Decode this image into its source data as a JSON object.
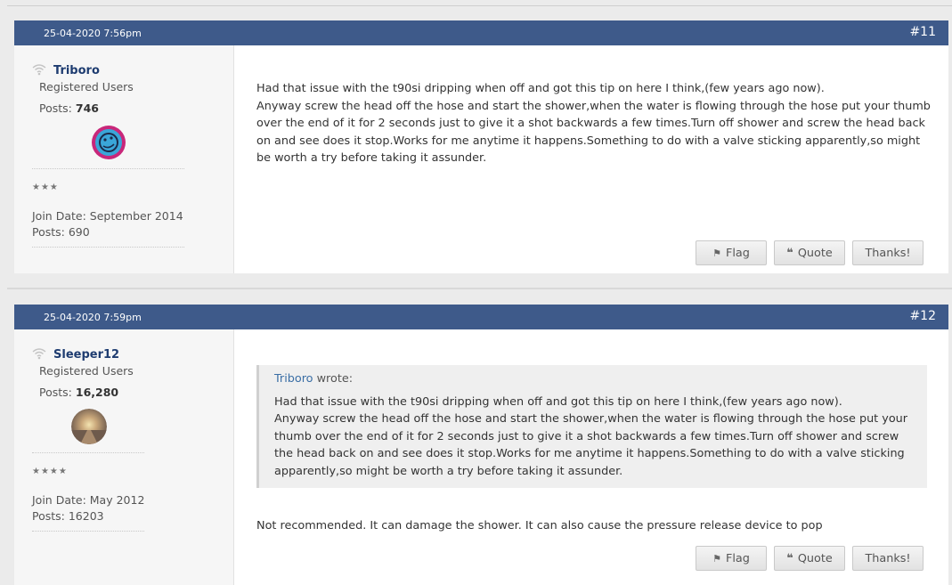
{
  "posts": [
    {
      "date": "25-04-2020 7:56pm",
      "number": "#11",
      "user": {
        "name": "Triboro",
        "title": "Registered Users",
        "posts_label": "Posts:",
        "posts_value": "746",
        "stars": "★★★",
        "join_date": "Join Date: September 2014",
        "posts_line": "Posts: 690"
      },
      "content": [
        "Had that issue with the t90si dripping when off and got this tip on here I think,(few years ago now).",
        "Anyway screw the head off the hose and start the shower,when the water is flowing through the hose put your thumb over the end of it for 2 seconds just to give it a shot backwards a few times.Turn off shower and screw the head back on and see does it stop.Works for me anytime it happens.Something to do with a valve sticking apparently,so might be worth a try before taking it assunder."
      ],
      "buttons": {
        "flag": "Flag",
        "quote": "Quote",
        "thanks": "Thanks!"
      }
    },
    {
      "date": "25-04-2020 7:59pm",
      "number": "#12",
      "user": {
        "name": "Sleeper12",
        "title": "Registered Users",
        "posts_label": "Posts:",
        "posts_value": "16,280",
        "stars": "★★★★",
        "join_date": "Join Date: May 2012",
        "posts_line": "Posts: 16203"
      },
      "quote": {
        "author": "Triboro",
        "wrote": "wrote:",
        "lines": [
          "Had that issue with the t90si dripping when off and got this tip on here I think,(few years ago now).",
          "Anyway screw the head off the hose and start the shower,when the water is flowing through the hose put your thumb over the end of it for 2 seconds just to give it a shot backwards a few times.Turn off shower and screw the head back on and see does it stop.Works for me anytime it happens.Something to do with a valve sticking apparently,so might be worth a try before taking it assunder."
        ]
      },
      "content": "Not recommended. It can damage the shower. It can also cause the pressure release device to pop",
      "buttons": {
        "flag": "Flag",
        "quote": "Quote",
        "thanks": "Thanks!"
      }
    }
  ],
  "colors": {
    "header": "#3e5a8a",
    "username": "#1e3c70",
    "quote_link": "#3a6ea5"
  },
  "icons": {
    "online": "wifi-icon",
    "flag": "flag-icon",
    "quote": "quote-icon"
  }
}
